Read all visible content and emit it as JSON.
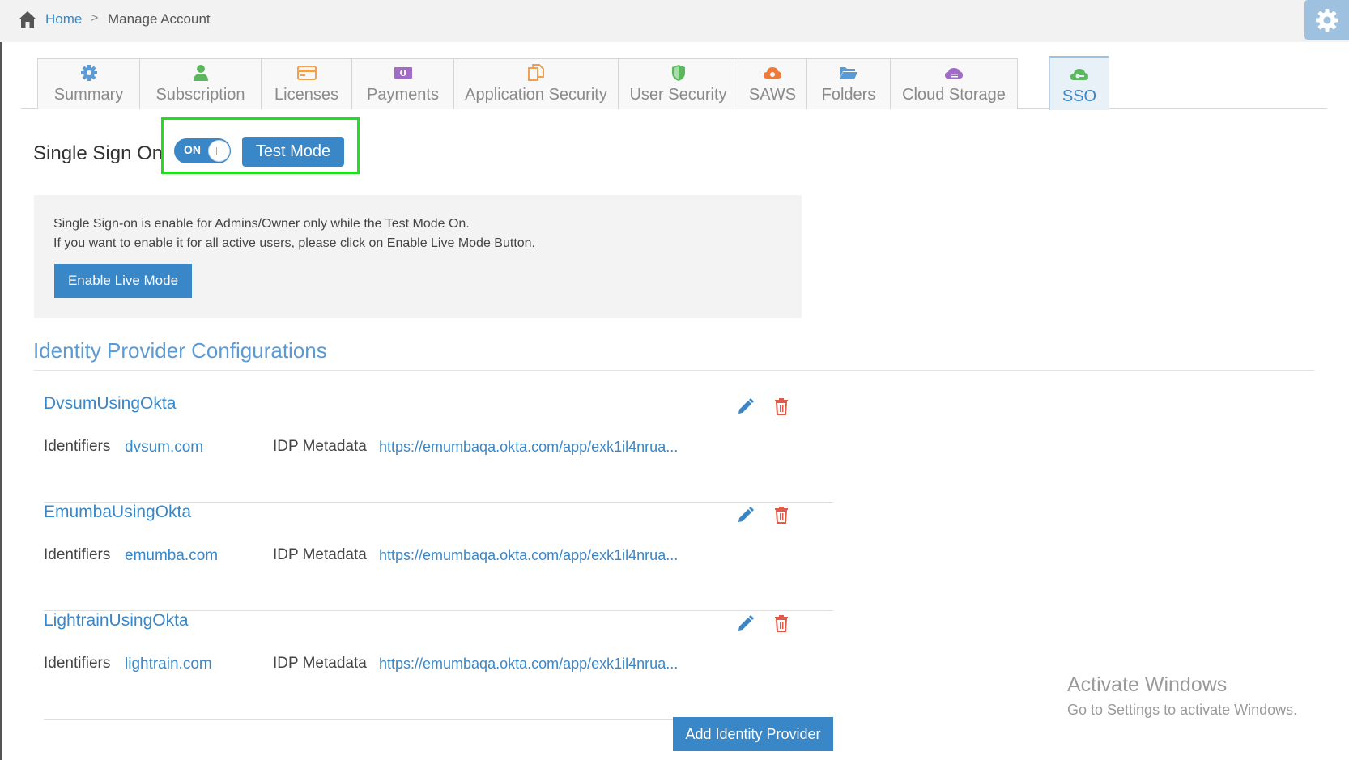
{
  "breadcrumb": {
    "home_label": "Home",
    "separator": ">",
    "current_label": "Manage Account"
  },
  "tabs": [
    {
      "label": "Summary",
      "icon": "gear-icon",
      "color": "#5b9bd5"
    },
    {
      "label": "Subscription",
      "icon": "user-icon",
      "color": "#5cb85c"
    },
    {
      "label": "Licenses",
      "icon": "credit-card-icon",
      "color": "#f0a050"
    },
    {
      "label": "Payments",
      "icon": "money-icon",
      "color": "#a06cc8"
    },
    {
      "label": "Application Security",
      "icon": "copy-icon",
      "color": "#f0a050"
    },
    {
      "label": "User Security",
      "icon": "shield-icon",
      "color": "#5cb85c"
    },
    {
      "label": "SAWS",
      "icon": "cloud-gear-icon",
      "color": "#f07a3a"
    },
    {
      "label": "Folders",
      "icon": "folder-open-icon",
      "color": "#5b9bd5"
    },
    {
      "label": "Cloud Storage",
      "icon": "cloud-storage-icon",
      "color": "#a06cc8"
    },
    {
      "label": "SSO",
      "icon": "cloud-key-icon",
      "color": "#5cb85c",
      "active": true
    }
  ],
  "sso": {
    "title": "Single Sign On",
    "toggle_label": "ON",
    "test_mode_label": "Test Mode"
  },
  "info": {
    "line1": "Single Sign-on is enable for Admins/Owner only while the Test Mode On.",
    "line2": "If you want to enable it for all active users, please click on Enable Live Mode Button.",
    "enable_live_label": "Enable Live Mode"
  },
  "idp": {
    "heading": "Identity Provider Configurations",
    "identifiers_label": "Identifiers",
    "metadata_label": "IDP Metadata",
    "items": [
      {
        "name": "DvsumUsingOkta",
        "identifier": "dvsum.com",
        "metadata": "https://emumbaqa.okta.com/app/exk1il4nrua..."
      },
      {
        "name": "EmumbaUsingOkta",
        "identifier": "emumba.com",
        "metadata": "https://emumbaqa.okta.com/app/exk1il4nrua..."
      },
      {
        "name": "LightrainUsingOkta",
        "identifier": "lightrain.com",
        "metadata": "https://emumbaqa.okta.com/app/exk1il4nrua..."
      }
    ],
    "add_label": "Add Identity Provider"
  },
  "watermark": {
    "title": "Activate Windows",
    "subtitle": "Go to Settings to activate Windows."
  },
  "colors": {
    "accent": "#3a87c8",
    "highlight": "#22dd22",
    "danger": "#e05a4a"
  }
}
